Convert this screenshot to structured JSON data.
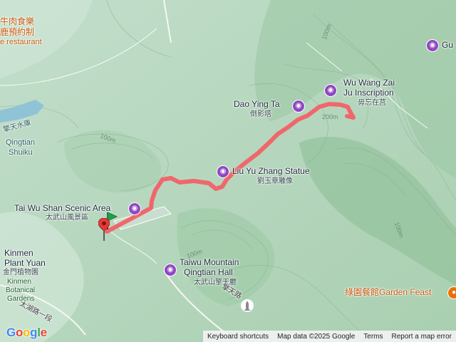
{
  "labels": {
    "food_top_line1": "牛肉食樂",
    "food_top_line2": "鹿預約制",
    "food_top_en": "e restaurant",
    "reservoir_cn": "擎天水庫",
    "reservoir_en1": "Qingtian",
    "reservoir_en2": "Shuiku",
    "scenic_en": "Tai Wu Shan Scenic Area",
    "scenic_cn": "太武山風景區",
    "daoying_en": "Dao Ying Ta",
    "daoying_cn": "倒影塔",
    "wuwang_en1": "Wu Wang Zai",
    "wuwang_en2": "Ju Inscription",
    "wuwang_cn": "毋忘在莒",
    "liu_en": "Liu Yu Zhang Statue",
    "liu_cn": "劉玉章雕像",
    "taiwu_en1": "Taiwu Mountain",
    "taiwu_en2": "Qingtian Hall",
    "taiwu_cn": "太武山擎天廳",
    "plant_en1": "Kinmen",
    "plant_en2": "Plant Yuan",
    "plant_cn": "金門植物園",
    "plant_alt1": "Kinmen",
    "plant_alt2": "Botanical",
    "plant_alt3": "Gardens",
    "garden_feast": "綠園餐館Garden Feast",
    "gu_partial": "Gu",
    "road_qingtian": "擎天路",
    "road_taihu": "太湖路一段",
    "contour_100_top": "100m",
    "contour_100_left": "100m",
    "contour_200": "200m",
    "contour_100_right": "100m",
    "contour_100_bottom": "100m"
  },
  "footer": {
    "logo": "Google",
    "shortcuts": "Keyboard shortcuts",
    "map_data": "Map data ©2025 Google",
    "terms": "Terms",
    "report": "Report a map error"
  },
  "icons": {
    "camera": "camera-icon",
    "utensils": "restaurant-icon",
    "monument": "monument-icon",
    "start": "start-flag-icon",
    "end": "end-pin-icon"
  },
  "colors": {
    "route": "#f0676b",
    "terrain": "#b8d7be",
    "poi": "#9048c2",
    "food": "#e8710a"
  }
}
